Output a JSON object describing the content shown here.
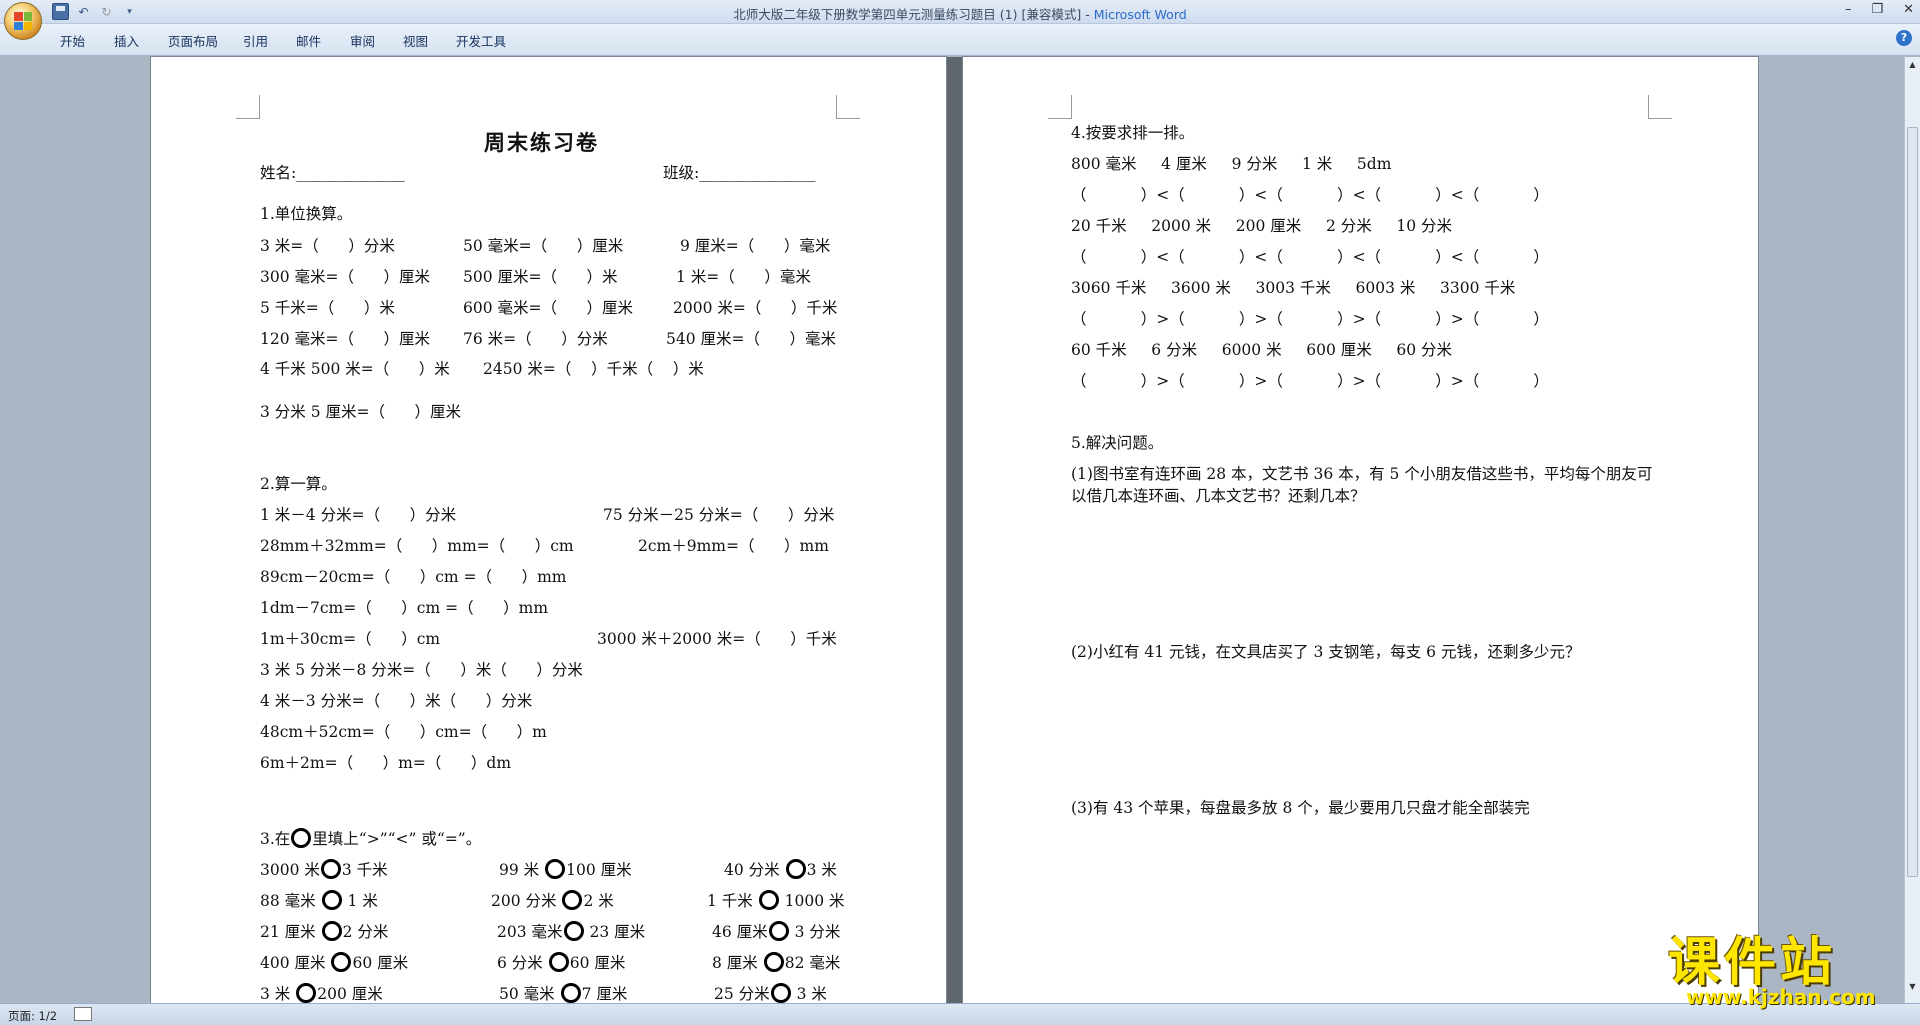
{
  "window": {
    "title_doc": "北师大版二年级下册数学第四单元测量练习题目 (1) [兼容模式]",
    "title_sep": " - ",
    "title_app": "Microsoft Word"
  },
  "ribbon": {
    "tabs": [
      "开始",
      "插入",
      "页面布局",
      "引用",
      "邮件",
      "审阅",
      "视图",
      "开发工具"
    ]
  },
  "page1": {
    "title": "周末练习卷",
    "name_label": "姓名:______________",
    "class_label": "班级:_______________",
    "sec1_title": "1.单位换算。",
    "sec1": [
      [
        "3 米=（      ）分米",
        "50 毫米=（      ）厘米",
        "9 厘米=（      ）毫米"
      ],
      [
        "300 毫米=（      ）厘米",
        "500 厘米=（      ）米",
        "1 米=（      ）毫米"
      ],
      [
        "5 千米=（      ）米",
        "600 毫米=（      ）厘米",
        "2000 米=（      ）千米"
      ],
      [
        "120 毫米=（      ）厘米",
        "76 米=（      ）分米",
        "540 厘米=（      ）毫米"
      ],
      [
        "4 千米 500 米=（      ）米",
        "2450 米=（    ）千米（    ）米",
        ""
      ]
    ],
    "sec1_extra": "3 分米 5 厘米=（      ）厘米",
    "sec2_title": "2.算一算。",
    "sec2": [
      [
        "1 米－4 分米=（      ）分米",
        "75 分米－25 分米=（      ）分米"
      ],
      [
        "28mm＋32mm=（      ）mm=（      ）cm",
        "2cm＋9mm=（      ）mm"
      ],
      [
        "89cm－20cm=（      ）cm =（      ）mm",
        ""
      ],
      [
        "1dm－7cm=（      ）cm =（      ）mm",
        ""
      ],
      [
        "1m＋30cm=（      ）cm",
        "3000 米＋2000 米=（      ）千米"
      ],
      [
        "3 米 5 分米－8 分米=（      ）米（      ）分米",
        ""
      ],
      [
        "4 米－3 分米=（      ）米（      ）分米",
        ""
      ],
      [
        "48cm＋52cm=（      ）cm=（      ）m",
        ""
      ],
      [
        "6m＋2m=（      ）m=（      ）dm",
        ""
      ]
    ],
    "sec3_pre": "3.在",
    "sec3_post": "里填上“>”“<” 或“=”。",
    "sec3": [
      [
        [
          "3000 米",
          "3 千米"
        ],
        [
          "99 米",
          "100 厘米"
        ],
        [
          "40 分米",
          "3 米"
        ]
      ],
      [
        [
          "88 毫米",
          "1 米"
        ],
        [
          "200 分米",
          "2 米"
        ],
        [
          "1 千米",
          "1000 米"
        ]
      ],
      [
        [
          "21 厘米",
          "2 分米"
        ],
        [
          "203 毫米",
          "23 厘米"
        ],
        [
          "46 厘米",
          "3 分米"
        ]
      ],
      [
        [
          "400 厘米",
          "60 厘米"
        ],
        [
          "6 分米",
          "60 厘米"
        ],
        [
          "8 厘米",
          "82 毫米"
        ]
      ],
      [
        [
          "3 米",
          "200 厘米"
        ],
        [
          "50 毫米",
          "7 厘米"
        ],
        [
          "25 分米",
          "3 米"
        ]
      ]
    ]
  },
  "page2": {
    "sec4_title": "4.按要求排一排。",
    "groups": [
      {
        "items": "800 毫米     4 厘米     9 分米     1 米     5dm",
        "order": "（           ）<（           ）<（           ）<（           ）<（           ）"
      },
      {
        "items": "20 千米     2000 米     200 厘米     2 分米     10 分米",
        "order": "（           ）<（           ）<（           ）<（           ）<（           ）"
      },
      {
        "items": "3060 千米     3600 米     3003 千米     6003 米     3300 千米",
        "order": "（           ）>（           ）>（           ）>（           ）>（           ）"
      },
      {
        "items": "60 千米     6 分米     6000 米     600 厘米     60 分米",
        "order": "（           ）>（           ）>（           ）>（           ）>（           ）"
      }
    ],
    "sec5_title": "5.解决问题。",
    "q1_line1": "(1)图书室有连环画 28 本，文艺书 36 本，有 5 个小朋友借这些书，平均每个朋友可",
    "q1_line2": "以借几本连环画、几本文艺书？还剩几本？",
    "q2": "(2)小红有 41 元钱，在文具店买了 3 支钢笔，每支 6 元钱，还剩多少元？",
    "q3": "(3)有 43 个苹果，每盘最多放 8 个，最少要用几只盘才能全部装完"
  },
  "statusbar": {
    "page_info": "页面: 1/2"
  },
  "watermark": {
    "text": "课件站",
    "url": "www.kjzhan.com"
  }
}
